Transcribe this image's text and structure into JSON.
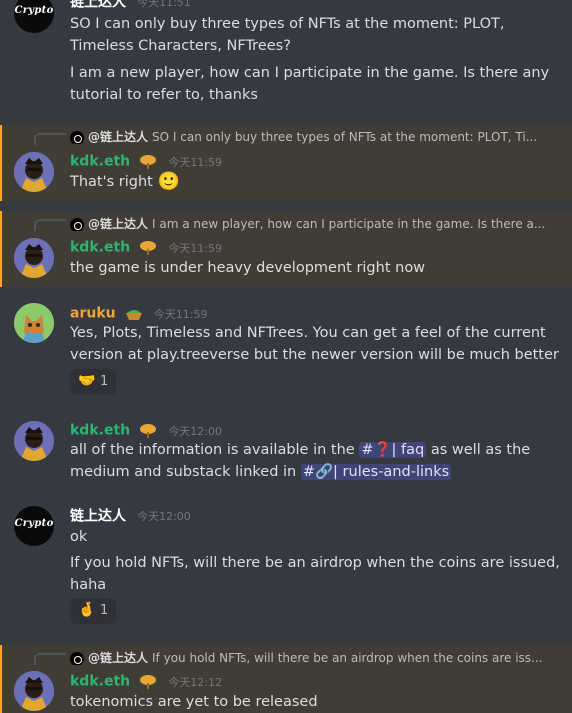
{
  "messages": [
    {
      "author": "链上达人",
      "time": "今天11:51",
      "lines": [
        "SO I can only buy three types of NFTs at the moment: PLOT, Timeless Characters, NFTrees?",
        "I am a new player, how can I participate in the game. Is there any tutorial to refer to, thanks"
      ],
      "avatar_text": "Crypto"
    },
    {
      "reply_to": {
        "author": "@链上达人",
        "text": "SO I can only buy three types of NFTs at the moment: PLOT, Ti..."
      },
      "author": "kdk.eth",
      "time": "今天11:59",
      "text": "That's right",
      "emoji": "🙂"
    },
    {
      "reply_to": {
        "author": "@链上达人",
        "text": "I am a new player, how can I participate in the game. Is there a..."
      },
      "author": "kdk.eth",
      "time": "今天11:59",
      "text": "the game is under heavy development right now"
    },
    {
      "author": "aruku",
      "time": "今天11:59",
      "text": "Yes, Plots, Timeless and NFTrees. You can get a feel of the current version at play.treeverse but the newer version will be much better",
      "reaction": {
        "emoji": "🤝",
        "count": "1"
      }
    },
    {
      "author": "kdk.eth",
      "time": "今天12:00",
      "text_pre": "all of the information is available in the",
      "channel1": "#❓| faq",
      "text_mid": "as well as the medium and substack linked in",
      "channel2": "#🔗| rules-and-links"
    },
    {
      "author": "链上达人",
      "time": "今天12:00",
      "avatar_text": "Crypto",
      "line1": "ok",
      "line2": "If you hold NFTs, will there be an airdrop when the coins are issued, haha",
      "reaction": {
        "emoji": "🤞",
        "count": "1"
      }
    },
    {
      "reply_to": {
        "author": "@链上达人",
        "text": "If you hold NFTs, will there be an airdrop when the coins are iss..."
      },
      "author": "kdk.eth",
      "time": "今天12:12",
      "text": "tokenomics are yet to be released"
    }
  ],
  "colors": {
    "background": "#36393f",
    "highlight": "#3f3d36",
    "kdk_name": "#2bb673",
    "aruku_name": "#f0a43a",
    "channel_pill": "#5865f2"
  }
}
